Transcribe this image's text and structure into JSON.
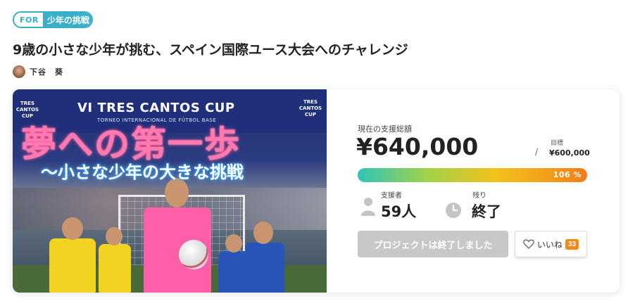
{
  "badge": {
    "prefix": "FOR",
    "category": "少年の挑戦"
  },
  "project": {
    "title": "9歳の小さな少年が挑む、スペイン国際ユース大会へのチャレンジ"
  },
  "owner": {
    "name": "下谷　葵"
  },
  "image": {
    "banner_text": "VI TRES CANTOS CUP",
    "banner_sub": "TORNEO INTERNACIONAL DE FÚTBOL BASE",
    "logo_text": "TRES CANTOS CUP",
    "headline": "夢への第一歩",
    "subheadline": "～小さな少年の大きな挑戦"
  },
  "funding": {
    "total_label": "現在の支援総額",
    "total_amount": "¥640,000",
    "goal_label": "目標",
    "goal_amount": "¥600,000",
    "progress_text": "106 %",
    "progress_percent": 106
  },
  "stats": {
    "supporters_label": "支援者",
    "supporters_value": "59人",
    "remaining_label": "残り",
    "remaining_value": "終了"
  },
  "actions": {
    "ended_button": "プロジェクトは終了しました",
    "like_label": "いいね",
    "like_count": "33"
  },
  "icons": {
    "supporters": "person-icon",
    "remaining": "clock-icon",
    "like": "heart-icon"
  },
  "colors": {
    "accent": "#3ab0c8",
    "like_badge": "#f08a1a",
    "disabled_button": "#c8c8c8"
  }
}
